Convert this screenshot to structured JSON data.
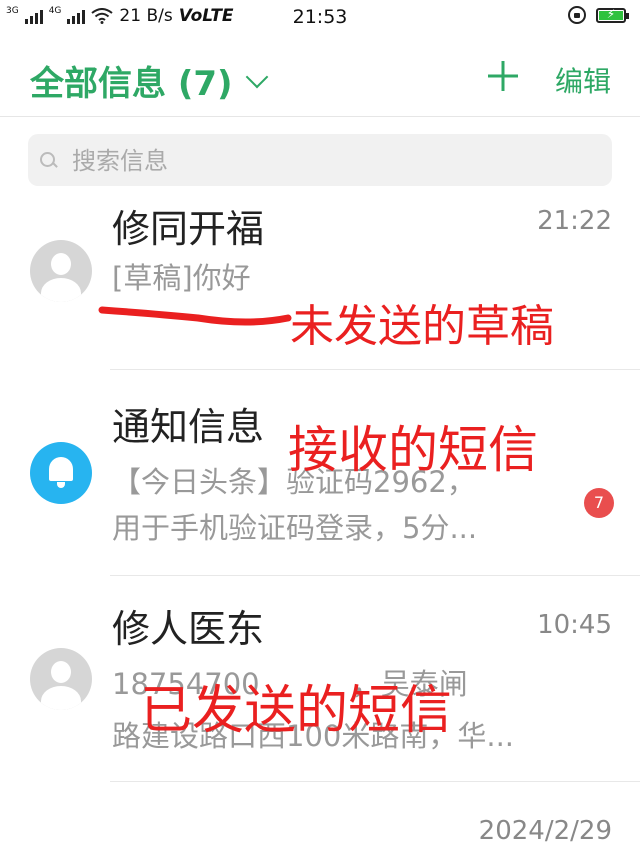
{
  "status_bar": {
    "network1": "3G",
    "network2": "4G",
    "speed": "21 B/s",
    "volte": "VoLTE",
    "time": "21:53"
  },
  "header": {
    "title": "全部信息 (7)",
    "edit_label": "编辑"
  },
  "search": {
    "placeholder": "搜索信息"
  },
  "messages": [
    {
      "name": "修同开福",
      "time": "21:22",
      "line1": "[草稿]你好",
      "line2": "",
      "unread": null,
      "avatar": "person"
    },
    {
      "name": "通知信息",
      "time": "",
      "line1": "【今日头条】验证码2962，",
      "line2": "用于手机验证码登录，5分...",
      "unread": "7",
      "avatar": "bell"
    },
    {
      "name": "修人医东",
      "time": "10:45",
      "line1": "18754700          ，吴泰闸",
      "line2": "路建设路口西100米路南，华...",
      "unread": null,
      "avatar": "person"
    },
    {
      "name": "",
      "time": "2024/2/29",
      "line1": "",
      "line2": "",
      "unread": null,
      "avatar": "person"
    }
  ],
  "annotations": {
    "draft": "未发送的草稿",
    "received": "接收的短信",
    "sent": "已发送的短信"
  },
  "colors": {
    "accent": "#2ea865",
    "annotation": "#ea2020",
    "badge": "#e94e4e",
    "bell": "#27b4f0"
  }
}
